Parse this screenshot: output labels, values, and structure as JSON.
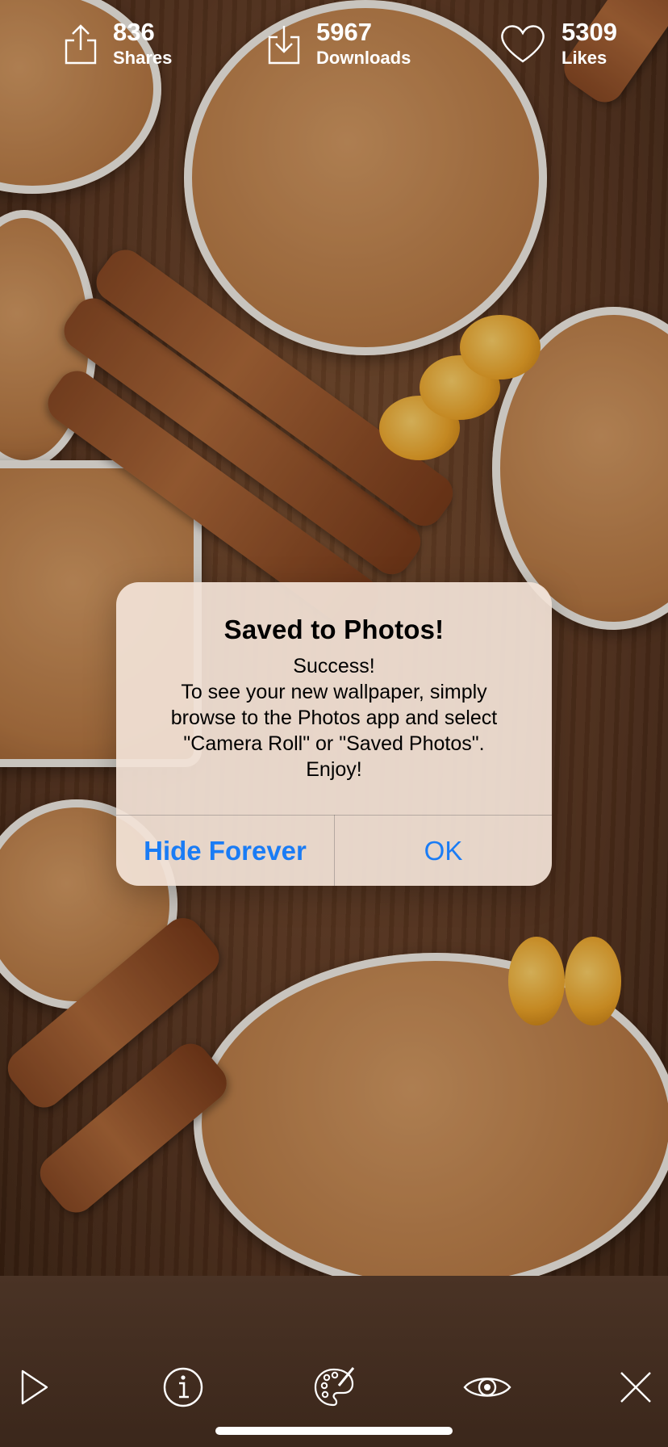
{
  "alert": {
    "title": "Saved to Photos!",
    "message_lines": [
      "Success!",
      "To see your new wallpaper, simply",
      "browse to the Photos app and select",
      "\"Camera Roll\" or \"Saved Photos\".",
      "Enjoy!"
    ],
    "button_hide": "Hide Forever",
    "button_ok": "OK",
    "button_color": "#1a7cf5"
  },
  "stats": {
    "shares": {
      "value": "836",
      "label": "Shares",
      "icon": "share-icon"
    },
    "downloads": {
      "value": "5967",
      "label": "Downloads",
      "icon": "download-icon"
    },
    "likes": {
      "value": "5309",
      "label": "Likes",
      "icon": "heart-icon"
    }
  },
  "toolbar": [
    {
      "name": "play-icon"
    },
    {
      "name": "info-icon"
    },
    {
      "name": "palette-icon"
    },
    {
      "name": "eye-icon"
    },
    {
      "name": "close-icon"
    }
  ]
}
